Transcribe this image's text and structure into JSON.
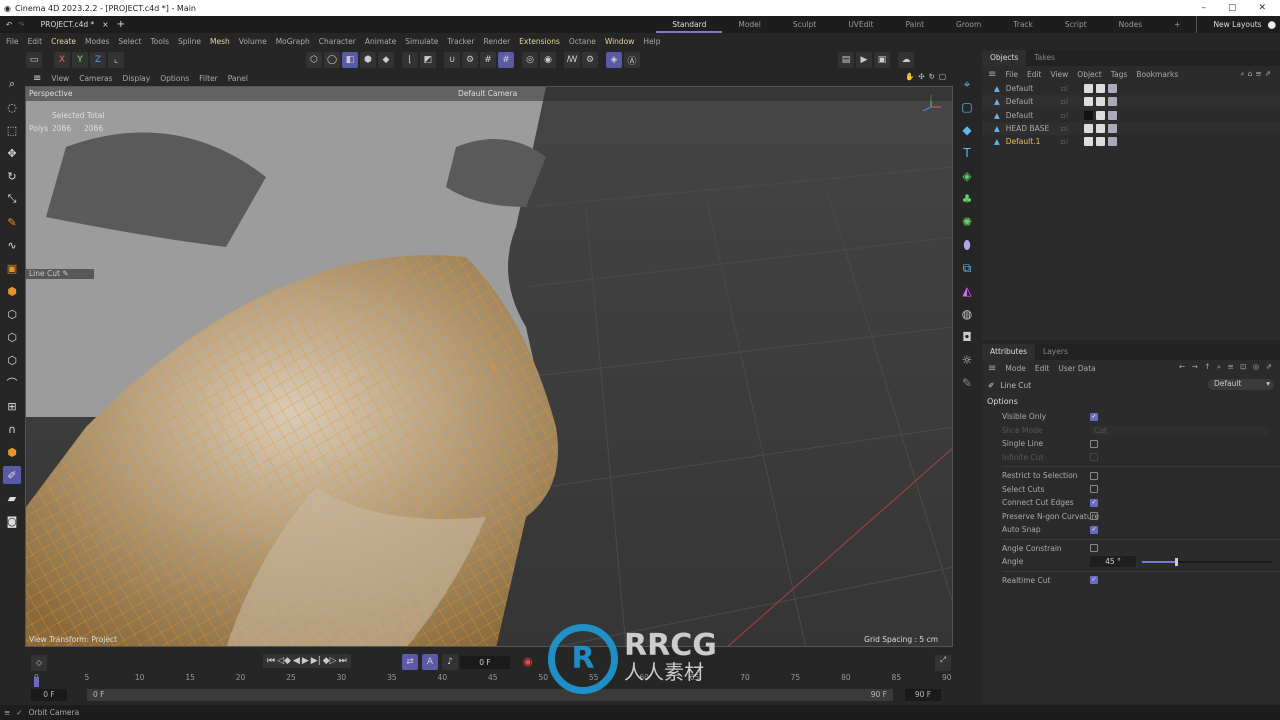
{
  "window": {
    "title": "Cinema 4D 2023.2.2 - [PROJECT.c4d *] - Main",
    "controls": [
      "–",
      "▢",
      "✕"
    ]
  },
  "doc_tab": {
    "label": "PROJECT.c4d *",
    "close": "×",
    "add": "+"
  },
  "layouts": {
    "items": [
      "Standard",
      "Model",
      "Sculpt",
      "UVEdit",
      "Paint",
      "Groom",
      "Track",
      "Script",
      "Nodes"
    ],
    "active": "Standard",
    "add": "+",
    "new_layouts": "New Layouts"
  },
  "menu": [
    "File",
    "Edit",
    "Create",
    "Modes",
    "Select",
    "Tools",
    "Spline",
    "Mesh",
    "Volume",
    "MoGraph",
    "Character",
    "Animate",
    "Simulate",
    "Tracker",
    "Render",
    "Extensions",
    "Octane",
    "Window",
    "Help"
  ],
  "menu_highlight": [
    "Create",
    "Mesh",
    "Extensions",
    "Window"
  ],
  "toolbar": {
    "axes": [
      "X",
      "Y",
      "Z"
    ]
  },
  "viewport": {
    "menu": [
      "View",
      "Cameras",
      "Display",
      "Options",
      "Filter",
      "Panel"
    ],
    "name": "Perspective",
    "camera": "Default Camera",
    "stats": {
      "selected_label": "Selected",
      "total_label": "Total",
      "row_label": "Polys",
      "selected": "2086",
      "total": "2086"
    },
    "tool_label": "Line Cut",
    "view_transform": "View Transform: Project",
    "grid_spacing": "Grid Spacing : 5 cm",
    "colors": {
      "mesh": "#e8932a",
      "background": "#3d3d3d"
    }
  },
  "objects": {
    "tabs": [
      "Objects",
      "Takes"
    ],
    "menu": [
      "File",
      "Edit",
      "View",
      "Object",
      "Tags",
      "Bookmarks"
    ],
    "items": [
      {
        "name": "Default"
      },
      {
        "name": "Default"
      },
      {
        "name": "Default"
      },
      {
        "name": "HEAD BASE"
      },
      {
        "name": "Default.1",
        "selected": true
      }
    ]
  },
  "attributes": {
    "tabs": [
      "Attributes",
      "Layers"
    ],
    "menu": [
      "Mode",
      "Edit",
      "User Data"
    ],
    "tool": "Line Cut",
    "preset": "Default",
    "section": "Options",
    "options": [
      {
        "label": "Visible Only",
        "checked": true
      },
      {
        "label": "Slice Mode",
        "value": "Cut",
        "disabled": true
      },
      {
        "label": "Single Line",
        "checked": false
      },
      {
        "label": "Infinite Cut",
        "checked": false,
        "disabled": true
      },
      {
        "label": "Restrict to Selection",
        "checked": false
      },
      {
        "label": "Select Cuts",
        "checked": false
      },
      {
        "label": "Connect Cut Edges",
        "checked": true
      },
      {
        "label": "Preserve N-gon Curvature",
        "checked": false
      },
      {
        "label": "Auto Snap",
        "checked": true
      },
      {
        "label": "Angle Constrain",
        "checked": false
      },
      {
        "label": "Angle",
        "value": "45 °",
        "slider_fraction": 0.25
      },
      {
        "label": "Realtime Cut",
        "checked": true
      }
    ]
  },
  "timeline": {
    "current": "0 F",
    "ticks": [
      "0",
      "5",
      "10",
      "15",
      "20",
      "25",
      "30",
      "35",
      "40",
      "45",
      "50",
      "55",
      "60",
      "65",
      "70",
      "75",
      "80",
      "85",
      "90"
    ],
    "start": "0 F",
    "range_start": "0 F",
    "range_end": "90 F",
    "end": "90 F"
  },
  "status": {
    "text": "Orbit Camera"
  },
  "watermark": {
    "text": "RRCG",
    "subtext": "人人素材"
  }
}
